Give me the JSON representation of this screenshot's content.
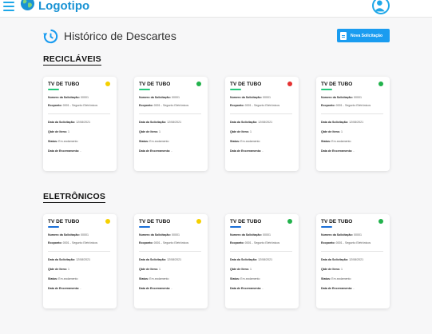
{
  "app": {
    "logo_text": "Logotipo",
    "icons": {
      "menu": "hamburger-menu-icon",
      "logo": "globe-icon",
      "avatar": "user-avatar-icon",
      "history": "history-icon",
      "new_request": "document-icon"
    }
  },
  "page": {
    "title": "Histórico de Descartes",
    "new_button_label": "Nova Solicitação"
  },
  "labels": {
    "number": "Numero da Solicitação:",
    "ecoponto": "Ecoponto:",
    "date": "Data da Solicitação:",
    "qty": "Qtde de Itens:",
    "status": "Status:",
    "close": "Data de Encerramento:"
  },
  "colors": {
    "yellow": "#f5d000",
    "green": "#22b24c",
    "red": "#e53232",
    "recycle_accent": "#22c97a",
    "electronic_accent": "#1a6fd8"
  },
  "sections": [
    {
      "title": "RECICLÁVEIS",
      "cards": [
        {
          "title": "TV DE TUBO",
          "status_color": "yellow",
          "number": "00001",
          "ecoponto": "0001 - Segunto Eletrônicos",
          "date": "12/08/2021",
          "qty": "1",
          "status": "Em andamento",
          "close": "-"
        },
        {
          "title": "TV DE TUBO",
          "status_color": "green",
          "number": "00001",
          "ecoponto": "0001 - Segunto Eletrônicos",
          "date": "12/08/2021",
          "qty": "1",
          "status": "Em andamento",
          "close": "-"
        },
        {
          "title": "TV DE TUBO",
          "status_color": "red",
          "number": "00001",
          "ecoponto": "0001 - Segunto Eletrônicos",
          "date": "12/08/2021",
          "qty": "1",
          "status": "Em andamento",
          "close": "-"
        },
        {
          "title": "TV DE TUBO",
          "status_color": "green",
          "number": "00001",
          "ecoponto": "0001 - Segunto Eletrônicos",
          "date": "12/08/2021",
          "qty": "1",
          "status": "Em andamento",
          "close": "-"
        }
      ]
    },
    {
      "title": "ELETRÔNICOS",
      "cards": [
        {
          "title": "TV DE TUBO",
          "status_color": "yellow",
          "number": "00001",
          "ecoponto": "0001 - Segunto Eletrônicos",
          "date": "12/08/2021",
          "qty": "1",
          "status": "Em andamento",
          "close": "-"
        },
        {
          "title": "TV DE TUBO",
          "status_color": "yellow",
          "number": "00001",
          "ecoponto": "0001 - Segunto Eletrônicos",
          "date": "12/08/2021",
          "qty": "1",
          "status": "Em andamento",
          "close": "-"
        },
        {
          "title": "TV DE TUBO",
          "status_color": "green",
          "number": "00001",
          "ecoponto": "0001 - Segunto Eletrônicos",
          "date": "12/08/2021",
          "qty": "1",
          "status": "Em andamento",
          "close": "-"
        },
        {
          "title": "TV DE TUBO",
          "status_color": "green",
          "number": "00001",
          "ecoponto": "0001 - Segunto Eletrônicos",
          "date": "12/08/2021",
          "qty": "1",
          "status": "Em andamento",
          "close": "-"
        }
      ]
    }
  ]
}
